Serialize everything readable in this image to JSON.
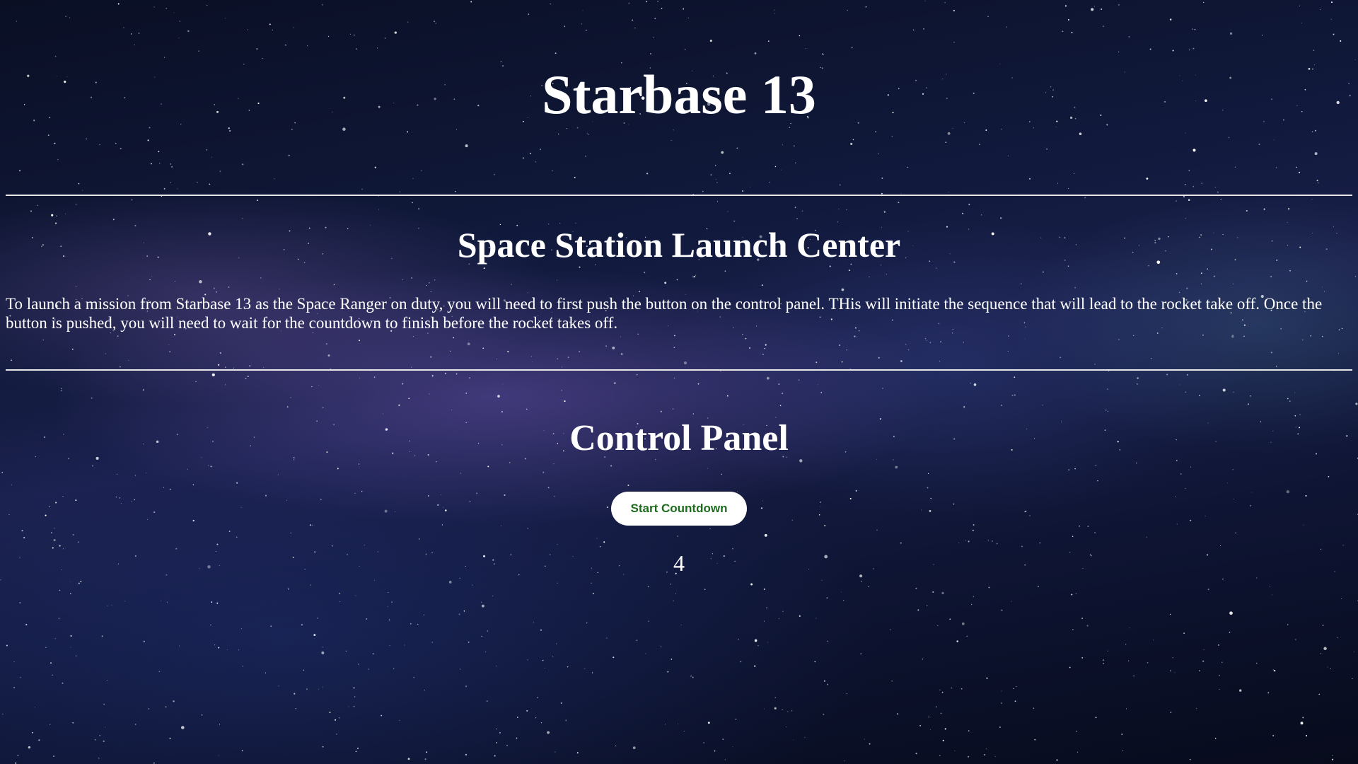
{
  "header": {
    "title": "Starbase 13"
  },
  "intro": {
    "heading": "Space Station Launch Center",
    "text": "To launch a mission from Starbase 13 as the Space Ranger on duty, you will need to first push the button on the control panel. THis will initiate the sequence that will lead to the rocket take off. Once the button is pushed, you will need to wait for the countdown to finish before the rocket takes off."
  },
  "control_panel": {
    "heading": "Control Panel",
    "button_label": "Start Countdown",
    "countdown_value": "4"
  },
  "colors": {
    "text": "#ffffff",
    "button_background": "#ffffff",
    "button_text": "#1d6b1d",
    "divider": "#e6e6e6"
  }
}
